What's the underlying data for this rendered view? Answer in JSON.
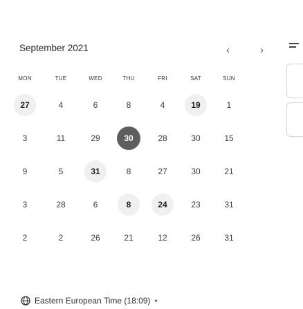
{
  "calendar": {
    "month_title": "September 2021",
    "prev_icon": "chevron-left-icon",
    "next_icon": "chevron-right-icon",
    "weekdays": [
      "MON",
      "TUE",
      "WED",
      "THU",
      "FRI",
      "SAT",
      "SUN"
    ],
    "weeks": [
      [
        {
          "label": "27",
          "state": "available"
        },
        {
          "label": "4",
          "state": "normal"
        },
        {
          "label": "6",
          "state": "normal"
        },
        {
          "label": "8",
          "state": "normal"
        },
        {
          "label": "4",
          "state": "normal"
        },
        {
          "label": "19",
          "state": "available"
        },
        {
          "label": "1",
          "state": "normal"
        }
      ],
      [
        {
          "label": "3",
          "state": "normal"
        },
        {
          "label": "11",
          "state": "normal"
        },
        {
          "label": "29",
          "state": "normal"
        },
        {
          "label": "30",
          "state": "selected"
        },
        {
          "label": "28",
          "state": "normal"
        },
        {
          "label": "30",
          "state": "normal"
        },
        {
          "label": "15",
          "state": "normal"
        }
      ],
      [
        {
          "label": "9",
          "state": "normal"
        },
        {
          "label": "5",
          "state": "normal"
        },
        {
          "label": "31",
          "state": "available"
        },
        {
          "label": "8",
          "state": "normal"
        },
        {
          "label": "27",
          "state": "normal"
        },
        {
          "label": "30",
          "state": "normal"
        },
        {
          "label": "21",
          "state": "normal"
        }
      ],
      [
        {
          "label": "3",
          "state": "normal"
        },
        {
          "label": "28",
          "state": "normal"
        },
        {
          "label": "6",
          "state": "normal"
        },
        {
          "label": "8",
          "state": "available"
        },
        {
          "label": "24",
          "state": "available"
        },
        {
          "label": "23",
          "state": "normal"
        },
        {
          "label": "31",
          "state": "normal"
        }
      ],
      [
        {
          "label": "2",
          "state": "normal"
        },
        {
          "label": "2",
          "state": "normal"
        },
        {
          "label": "26",
          "state": "normal"
        },
        {
          "label": "21",
          "state": "normal"
        },
        {
          "label": "12",
          "state": "normal"
        },
        {
          "label": "26",
          "state": "normal"
        },
        {
          "label": "31",
          "state": "normal"
        }
      ]
    ]
  },
  "timezone": {
    "icon": "globe-icon",
    "label": "Eastern European Time (18:09)",
    "dropdown_icon": "caret-down-icon"
  },
  "side_panel": {
    "icon": "menu-icon"
  },
  "colors": {
    "selected_bg": "#5e5e5e",
    "available_bg": "#f0f0f0"
  }
}
